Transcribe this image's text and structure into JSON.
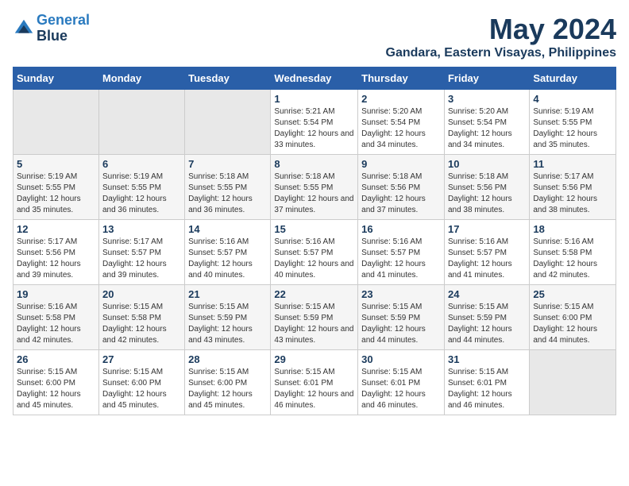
{
  "logo": {
    "line1": "General",
    "line2": "Blue"
  },
  "title": "May 2024",
  "location": "Gandara, Eastern Visayas, Philippines",
  "weekdays": [
    "Sunday",
    "Monday",
    "Tuesday",
    "Wednesday",
    "Thursday",
    "Friday",
    "Saturday"
  ],
  "weeks": [
    [
      {
        "day": "",
        "sunrise": "",
        "sunset": "",
        "daylight": ""
      },
      {
        "day": "",
        "sunrise": "",
        "sunset": "",
        "daylight": ""
      },
      {
        "day": "",
        "sunrise": "",
        "sunset": "",
        "daylight": ""
      },
      {
        "day": "1",
        "sunrise": "Sunrise: 5:21 AM",
        "sunset": "Sunset: 5:54 PM",
        "daylight": "Daylight: 12 hours and 33 minutes."
      },
      {
        "day": "2",
        "sunrise": "Sunrise: 5:20 AM",
        "sunset": "Sunset: 5:54 PM",
        "daylight": "Daylight: 12 hours and 34 minutes."
      },
      {
        "day": "3",
        "sunrise": "Sunrise: 5:20 AM",
        "sunset": "Sunset: 5:54 PM",
        "daylight": "Daylight: 12 hours and 34 minutes."
      },
      {
        "day": "4",
        "sunrise": "Sunrise: 5:19 AM",
        "sunset": "Sunset: 5:55 PM",
        "daylight": "Daylight: 12 hours and 35 minutes."
      }
    ],
    [
      {
        "day": "5",
        "sunrise": "Sunrise: 5:19 AM",
        "sunset": "Sunset: 5:55 PM",
        "daylight": "Daylight: 12 hours and 35 minutes."
      },
      {
        "day": "6",
        "sunrise": "Sunrise: 5:19 AM",
        "sunset": "Sunset: 5:55 PM",
        "daylight": "Daylight: 12 hours and 36 minutes."
      },
      {
        "day": "7",
        "sunrise": "Sunrise: 5:18 AM",
        "sunset": "Sunset: 5:55 PM",
        "daylight": "Daylight: 12 hours and 36 minutes."
      },
      {
        "day": "8",
        "sunrise": "Sunrise: 5:18 AM",
        "sunset": "Sunset: 5:55 PM",
        "daylight": "Daylight: 12 hours and 37 minutes."
      },
      {
        "day": "9",
        "sunrise": "Sunrise: 5:18 AM",
        "sunset": "Sunset: 5:56 PM",
        "daylight": "Daylight: 12 hours and 37 minutes."
      },
      {
        "day": "10",
        "sunrise": "Sunrise: 5:18 AM",
        "sunset": "Sunset: 5:56 PM",
        "daylight": "Daylight: 12 hours and 38 minutes."
      },
      {
        "day": "11",
        "sunrise": "Sunrise: 5:17 AM",
        "sunset": "Sunset: 5:56 PM",
        "daylight": "Daylight: 12 hours and 38 minutes."
      }
    ],
    [
      {
        "day": "12",
        "sunrise": "Sunrise: 5:17 AM",
        "sunset": "Sunset: 5:56 PM",
        "daylight": "Daylight: 12 hours and 39 minutes."
      },
      {
        "day": "13",
        "sunrise": "Sunrise: 5:17 AM",
        "sunset": "Sunset: 5:57 PM",
        "daylight": "Daylight: 12 hours and 39 minutes."
      },
      {
        "day": "14",
        "sunrise": "Sunrise: 5:16 AM",
        "sunset": "Sunset: 5:57 PM",
        "daylight": "Daylight: 12 hours and 40 minutes."
      },
      {
        "day": "15",
        "sunrise": "Sunrise: 5:16 AM",
        "sunset": "Sunset: 5:57 PM",
        "daylight": "Daylight: 12 hours and 40 minutes."
      },
      {
        "day": "16",
        "sunrise": "Sunrise: 5:16 AM",
        "sunset": "Sunset: 5:57 PM",
        "daylight": "Daylight: 12 hours and 41 minutes."
      },
      {
        "day": "17",
        "sunrise": "Sunrise: 5:16 AM",
        "sunset": "Sunset: 5:57 PM",
        "daylight": "Daylight: 12 hours and 41 minutes."
      },
      {
        "day": "18",
        "sunrise": "Sunrise: 5:16 AM",
        "sunset": "Sunset: 5:58 PM",
        "daylight": "Daylight: 12 hours and 42 minutes."
      }
    ],
    [
      {
        "day": "19",
        "sunrise": "Sunrise: 5:16 AM",
        "sunset": "Sunset: 5:58 PM",
        "daylight": "Daylight: 12 hours and 42 minutes."
      },
      {
        "day": "20",
        "sunrise": "Sunrise: 5:15 AM",
        "sunset": "Sunset: 5:58 PM",
        "daylight": "Daylight: 12 hours and 42 minutes."
      },
      {
        "day": "21",
        "sunrise": "Sunrise: 5:15 AM",
        "sunset": "Sunset: 5:59 PM",
        "daylight": "Daylight: 12 hours and 43 minutes."
      },
      {
        "day": "22",
        "sunrise": "Sunrise: 5:15 AM",
        "sunset": "Sunset: 5:59 PM",
        "daylight": "Daylight: 12 hours and 43 minutes."
      },
      {
        "day": "23",
        "sunrise": "Sunrise: 5:15 AM",
        "sunset": "Sunset: 5:59 PM",
        "daylight": "Daylight: 12 hours and 44 minutes."
      },
      {
        "day": "24",
        "sunrise": "Sunrise: 5:15 AM",
        "sunset": "Sunset: 5:59 PM",
        "daylight": "Daylight: 12 hours and 44 minutes."
      },
      {
        "day": "25",
        "sunrise": "Sunrise: 5:15 AM",
        "sunset": "Sunset: 6:00 PM",
        "daylight": "Daylight: 12 hours and 44 minutes."
      }
    ],
    [
      {
        "day": "26",
        "sunrise": "Sunrise: 5:15 AM",
        "sunset": "Sunset: 6:00 PM",
        "daylight": "Daylight: 12 hours and 45 minutes."
      },
      {
        "day": "27",
        "sunrise": "Sunrise: 5:15 AM",
        "sunset": "Sunset: 6:00 PM",
        "daylight": "Daylight: 12 hours and 45 minutes."
      },
      {
        "day": "28",
        "sunrise": "Sunrise: 5:15 AM",
        "sunset": "Sunset: 6:00 PM",
        "daylight": "Daylight: 12 hours and 45 minutes."
      },
      {
        "day": "29",
        "sunrise": "Sunrise: 5:15 AM",
        "sunset": "Sunset: 6:01 PM",
        "daylight": "Daylight: 12 hours and 46 minutes."
      },
      {
        "day": "30",
        "sunrise": "Sunrise: 5:15 AM",
        "sunset": "Sunset: 6:01 PM",
        "daylight": "Daylight: 12 hours and 46 minutes."
      },
      {
        "day": "31",
        "sunrise": "Sunrise: 5:15 AM",
        "sunset": "Sunset: 6:01 PM",
        "daylight": "Daylight: 12 hours and 46 minutes."
      },
      {
        "day": "",
        "sunrise": "",
        "sunset": "",
        "daylight": ""
      }
    ]
  ]
}
